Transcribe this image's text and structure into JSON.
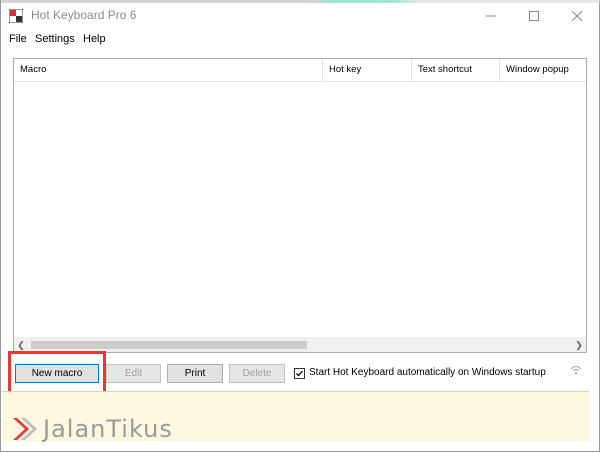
{
  "window": {
    "title": "Hot Keyboard Pro 6",
    "minimize_icon": "minimize-icon",
    "maximize_icon": "maximize-icon",
    "close_icon": "close-icon"
  },
  "menu": {
    "items": [
      "File",
      "Settings",
      "Help"
    ]
  },
  "list": {
    "columns": [
      "Macro",
      "Hot key",
      "Text shortcut",
      "Window popup"
    ],
    "rows": []
  },
  "buttons": {
    "new_macro": {
      "label": "New macro",
      "enabled": true
    },
    "edit": {
      "label": "Edit",
      "enabled": false
    },
    "print": {
      "label": "Print",
      "enabled": true
    },
    "delete": {
      "label": "Delete",
      "enabled": false
    }
  },
  "startup": {
    "label": "Start Hot Keyboard automatically on Windows startup",
    "checked": true
  },
  "watermark": {
    "text": "JalanTikus"
  },
  "colors": {
    "highlight": "#e53935",
    "status_panel": "#fdf8df"
  }
}
